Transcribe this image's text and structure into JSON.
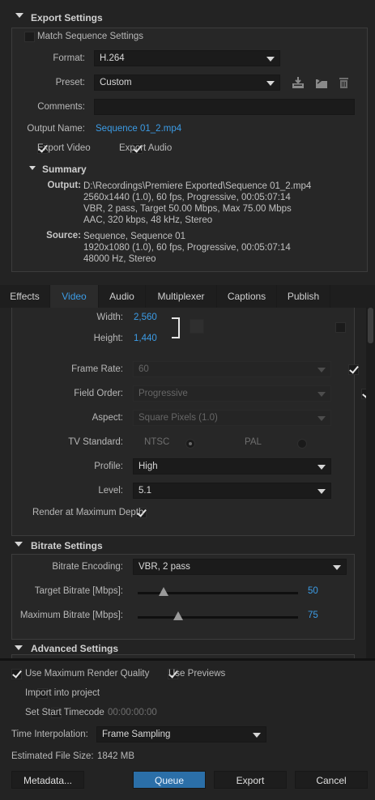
{
  "export_settings": {
    "header": "Export Settings",
    "match_sequence": {
      "label": "Match Sequence Settings",
      "checked": false
    },
    "format": {
      "label": "Format:",
      "value": "H.264"
    },
    "preset": {
      "label": "Preset:",
      "value": "Custom"
    },
    "comments": {
      "label": "Comments:",
      "value": ""
    },
    "output_name": {
      "label": "Output Name:",
      "value": "Sequence 01_2.mp4"
    },
    "export_video": {
      "label": "Export Video",
      "checked": true
    },
    "export_audio": {
      "label": "Export Audio",
      "checked": true
    },
    "summary": {
      "header": "Summary",
      "output_label": "Output:",
      "output_lines": [
        "D:\\Recordings\\Premiere Exported\\Sequence 01_2.mp4",
        "2560x1440 (1.0), 60 fps, Progressive, 00:05:07:14",
        "VBR, 2 pass, Target 50.00 Mbps, Max 75.00 Mbps",
        "AAC, 320 kbps, 48 kHz, Stereo"
      ],
      "source_label": "Source:",
      "source_lines": [
        "Sequence, Sequence 01",
        "1920x1080 (1.0), 60 fps, Progressive, 00:05:07:14",
        "48000 Hz, Stereo"
      ]
    }
  },
  "tabs": [
    "Effects",
    "Video",
    "Audio",
    "Multiplexer",
    "Captions",
    "Publish"
  ],
  "active_tab": "Video",
  "video": {
    "width": {
      "label": "Width:",
      "value": "2,560"
    },
    "height": {
      "label": "Height:",
      "value": "1,440"
    },
    "frame_rate": {
      "label": "Frame Rate:",
      "value": "60"
    },
    "field_order": {
      "label": "Field Order:",
      "value": "Progressive"
    },
    "aspect": {
      "label": "Aspect:",
      "value": "Square Pixels (1.0)"
    },
    "tv_standard": {
      "label": "TV Standard:",
      "ntsc": "NTSC",
      "pal": "PAL"
    },
    "profile": {
      "label": "Profile:",
      "value": "High"
    },
    "level": {
      "label": "Level:",
      "value": "5.1"
    },
    "render_max_depth": {
      "label": "Render at Maximum Depth",
      "checked": true
    }
  },
  "bitrate": {
    "header": "Bitrate Settings",
    "encoding": {
      "label": "Bitrate Encoding:",
      "value": "VBR, 2 pass"
    },
    "target": {
      "label": "Target Bitrate [Mbps]:",
      "value": "50",
      "fraction": 0.16
    },
    "maximum": {
      "label": "Maximum Bitrate [Mbps]:",
      "value": "75",
      "fraction": 0.25
    }
  },
  "advanced": {
    "header": "Advanced Settings"
  },
  "bottom": {
    "max_render_quality": {
      "label": "Use Maximum Render Quality",
      "checked": true
    },
    "use_previews": {
      "label": "Use Previews",
      "checked": true
    },
    "import_project": {
      "label": "Import into project",
      "checked": false
    },
    "start_timecode": {
      "label": "Set Start Timecode",
      "value": "00:00:00:00",
      "checked": false
    },
    "time_interp": {
      "label": "Time Interpolation:",
      "value": "Frame Sampling"
    },
    "file_size": {
      "label": "Estimated File Size:",
      "value": "1842 MB"
    },
    "buttons": {
      "metadata": "Metadata...",
      "queue": "Queue",
      "export": "Export",
      "cancel": "Cancel"
    }
  },
  "colors": {
    "accent": "#3c9ce6",
    "panel": "#232323",
    "primary_button": "#2b6fa8"
  }
}
